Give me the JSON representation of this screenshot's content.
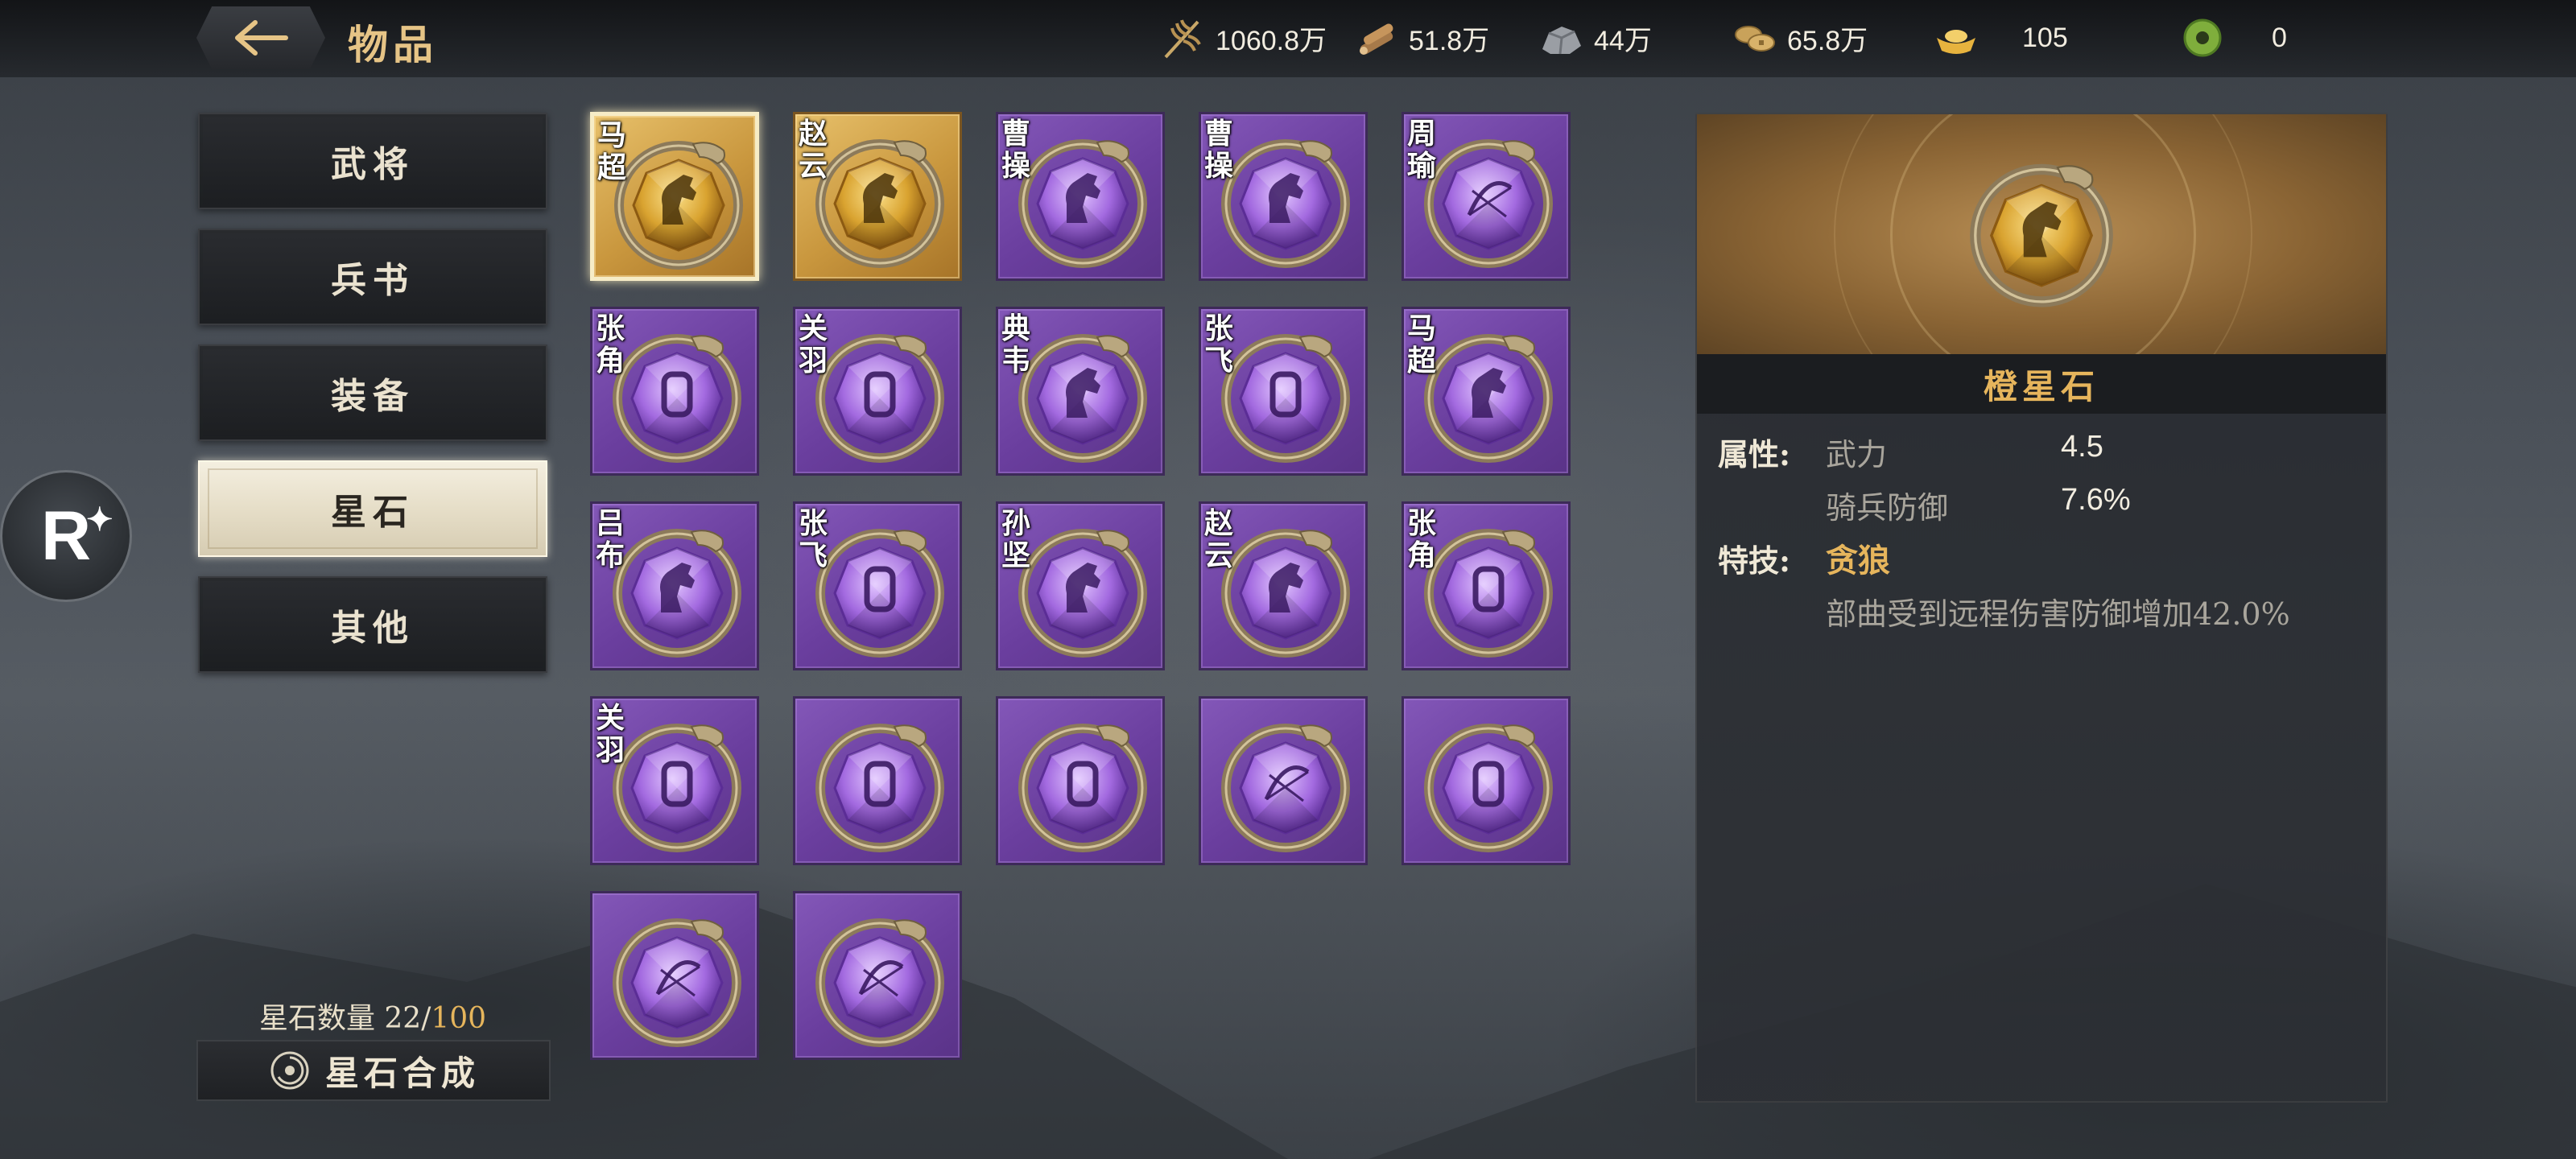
{
  "header": {
    "title": "物品",
    "back_icon": "back-arrow-icon"
  },
  "resources": [
    {
      "icon": "grain-icon",
      "value": "1060.8万"
    },
    {
      "icon": "wood-icon",
      "value": "51.8万"
    },
    {
      "icon": "stone-icon",
      "value": "44万"
    },
    {
      "icon": "copper-coin-icon",
      "value": "65.8万"
    },
    {
      "icon": "gold-ingot-icon",
      "value": "105"
    },
    {
      "icon": "jade-icon",
      "value": "0"
    }
  ],
  "menu": {
    "items": [
      {
        "label": "武将",
        "active": false
      },
      {
        "label": "兵书",
        "active": false
      },
      {
        "label": "装备",
        "active": false
      },
      {
        "label": "星石",
        "active": true
      },
      {
        "label": "其他",
        "active": false
      }
    ]
  },
  "floating_badge": {
    "letter": "R",
    "icon": "r-star-badge-icon"
  },
  "inventory": {
    "count_label": "星石数量 22/",
    "count_max": "100",
    "synth_label": "星石合成",
    "synth_icon": "synthesis-swirl-icon",
    "stones": [
      {
        "hero": "马超",
        "rarity": "orange",
        "glyph": "horse",
        "selected": true
      },
      {
        "hero": "赵云",
        "rarity": "orange",
        "glyph": "horse",
        "selected": false
      },
      {
        "hero": "曹操",
        "rarity": "purple",
        "glyph": "horse",
        "selected": false
      },
      {
        "hero": "曹操",
        "rarity": "purple",
        "glyph": "horse",
        "selected": false
      },
      {
        "hero": "周瑜",
        "rarity": "purple",
        "glyph": "bow",
        "selected": false
      },
      {
        "hero": "张角",
        "rarity": "purple",
        "glyph": "shield",
        "selected": false
      },
      {
        "hero": "关羽",
        "rarity": "purple",
        "glyph": "shield",
        "selected": false
      },
      {
        "hero": "典韦",
        "rarity": "purple",
        "glyph": "horse",
        "selected": false
      },
      {
        "hero": "张飞",
        "rarity": "purple",
        "glyph": "shield",
        "selected": false
      },
      {
        "hero": "马超",
        "rarity": "purple",
        "glyph": "horse",
        "selected": false
      },
      {
        "hero": "吕布",
        "rarity": "purple",
        "glyph": "horse",
        "selected": false
      },
      {
        "hero": "张飞",
        "rarity": "purple",
        "glyph": "shield",
        "selected": false
      },
      {
        "hero": "孙坚",
        "rarity": "purple",
        "glyph": "horse",
        "selected": false
      },
      {
        "hero": "赵云",
        "rarity": "purple",
        "glyph": "horse",
        "selected": false
      },
      {
        "hero": "张角",
        "rarity": "purple",
        "glyph": "shield",
        "selected": false
      },
      {
        "hero": "关羽",
        "rarity": "purple",
        "glyph": "shield",
        "selected": false
      },
      {
        "hero": "",
        "rarity": "purple",
        "glyph": "shield",
        "selected": false
      },
      {
        "hero": "",
        "rarity": "purple",
        "glyph": "shield",
        "selected": false
      },
      {
        "hero": "",
        "rarity": "purple",
        "glyph": "bow",
        "selected": false
      },
      {
        "hero": "",
        "rarity": "purple",
        "glyph": "shield",
        "selected": false
      },
      {
        "hero": "",
        "rarity": "purple",
        "glyph": "bow",
        "selected": false
      },
      {
        "hero": "",
        "rarity": "purple",
        "glyph": "bow",
        "selected": false
      }
    ]
  },
  "detail": {
    "name": "橙星石",
    "attr_label": "属性:",
    "attrs": [
      {
        "key": "武力",
        "value": "4.5"
      },
      {
        "key": "骑兵防御",
        "value": "7.6%"
      }
    ],
    "skill_label": "特技:",
    "skill_name": "贪狼",
    "skill_desc": "部曲受到远程伤害防御增加42.0%"
  },
  "colors": {
    "accent_gold": "#e6b55c",
    "purple_slot": "#7a4fb0",
    "orange_slot": "#d4a24c"
  }
}
